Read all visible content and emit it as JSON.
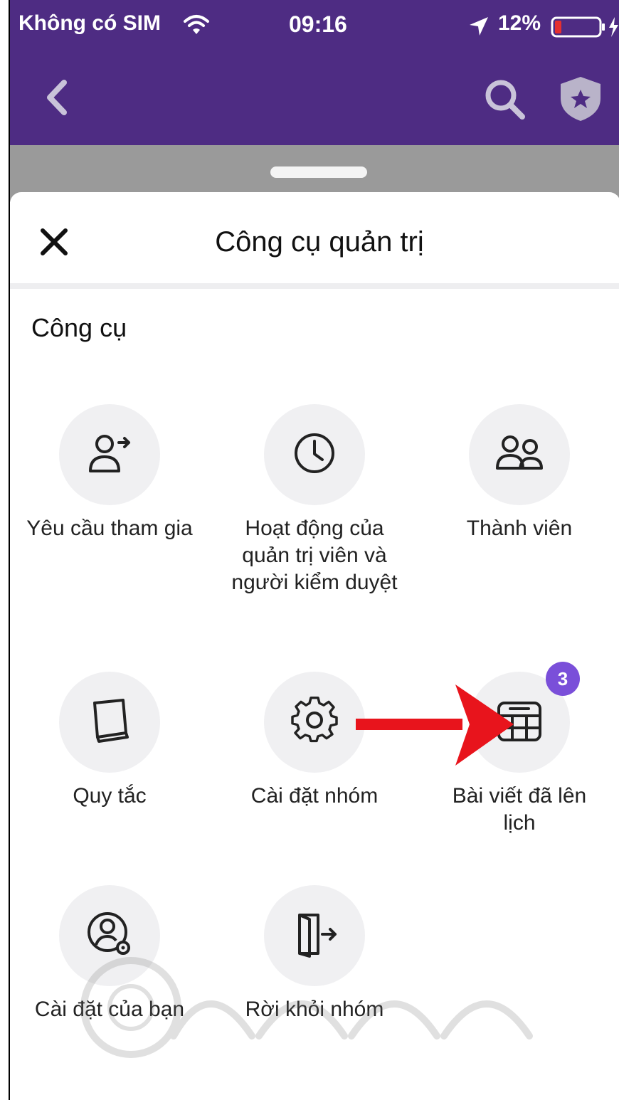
{
  "status_bar": {
    "carrier": "Không có SIM",
    "time": "09:16",
    "battery": "12%"
  },
  "sheet": {
    "title": "Công cụ quản trị",
    "section_title": "Công cụ"
  },
  "tools": [
    {
      "label": "Yêu cầu tham gia",
      "icon": "person-add-icon"
    },
    {
      "label": "Hoạt động của quản trị viên và người kiểm duyệt",
      "icon": "clock-icon"
    },
    {
      "label": "Thành viên",
      "icon": "members-icon"
    },
    {
      "label": "Quy tắc",
      "icon": "book-icon"
    },
    {
      "label": "Cài đặt nhóm",
      "icon": "gear-icon"
    },
    {
      "label": "Bài viết đã lên lịch",
      "icon": "calendar-icon",
      "badge": "3"
    },
    {
      "label": "Cài đặt của bạn",
      "icon": "user-settings-icon"
    },
    {
      "label": "Rời khỏi nhóm",
      "icon": "leave-door-icon"
    }
  ],
  "colors": {
    "header": "#4e2c83",
    "badge": "#7a4fd9",
    "arrow": "#e8141c"
  }
}
